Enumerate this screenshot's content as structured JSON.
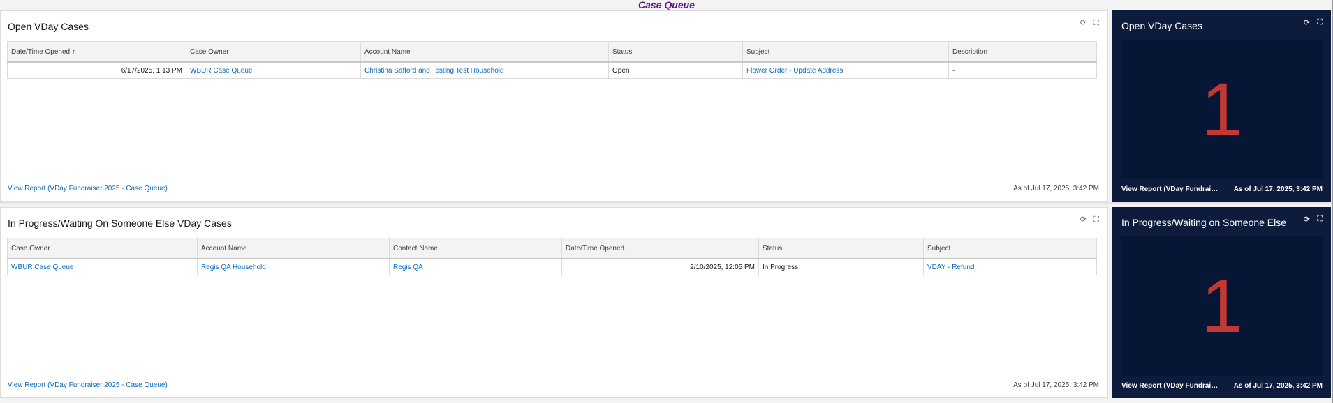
{
  "page": {
    "title": "Case Queue"
  },
  "panel1": {
    "title": "Open VDay Cases",
    "refresh_icon": "refresh-icon",
    "expand_icon": "expand-icon",
    "columns": [
      "Date/Time Opened",
      "Case Owner",
      "Account Name",
      "Status",
      "Subject",
      "Description"
    ],
    "sort_indicator": "↑",
    "rows": [
      {
        "opened": "6/17/2025, 1:13 PM",
        "owner": "WBUR Case Queue",
        "account": "Christina Safford and Testing Test Household",
        "status": "Open",
        "subject": "Flower Order - Update Address",
        "description": "-"
      }
    ],
    "footer_link": "View Report (VDay Fundraiser 2025 - Case Queue)",
    "timestamp": "As of Jul 17, 2025, 3:42 PM"
  },
  "panel2": {
    "title": "In Progress/Waiting On Someone Else VDay Cases",
    "refresh_icon": "refresh-icon",
    "expand_icon": "expand-icon",
    "columns": [
      "Case Owner",
      "Account Name",
      "Contact Name",
      "Date/Time Opened",
      "Status",
      "Subject"
    ],
    "sort_indicator": "↓",
    "rows": [
      {
        "owner": "WBUR Case Queue",
        "account": "Regis QA Household",
        "contact": "Regis QA",
        "opened": "2/10/2025, 12:05 PM",
        "status": "In Progress",
        "subject": "VDAY - Refund"
      }
    ],
    "footer_link": "View Report (VDay Fundraiser 2025 - Case Queue)",
    "timestamp": "As of Jul 17, 2025, 3:42 PM"
  },
  "metric1": {
    "title": "Open VDay Cases",
    "value": "1",
    "footer_link": "View Report (VDay Fundraiser...",
    "timestamp": "As of Jul 17, 2025, 3:42 PM"
  },
  "metric2": {
    "title": "In Progress/Waiting on Someone Else",
    "value": "1",
    "footer_link": "View Report (VDay Fundraiser...",
    "timestamp": "As of Jul 17, 2025, 3:42 PM"
  },
  "colors": {
    "title_purple": "#5b1390",
    "link_blue": "#0b6cbd",
    "metric_bg": "#0d1c3d",
    "metric_value": "#c23934"
  }
}
